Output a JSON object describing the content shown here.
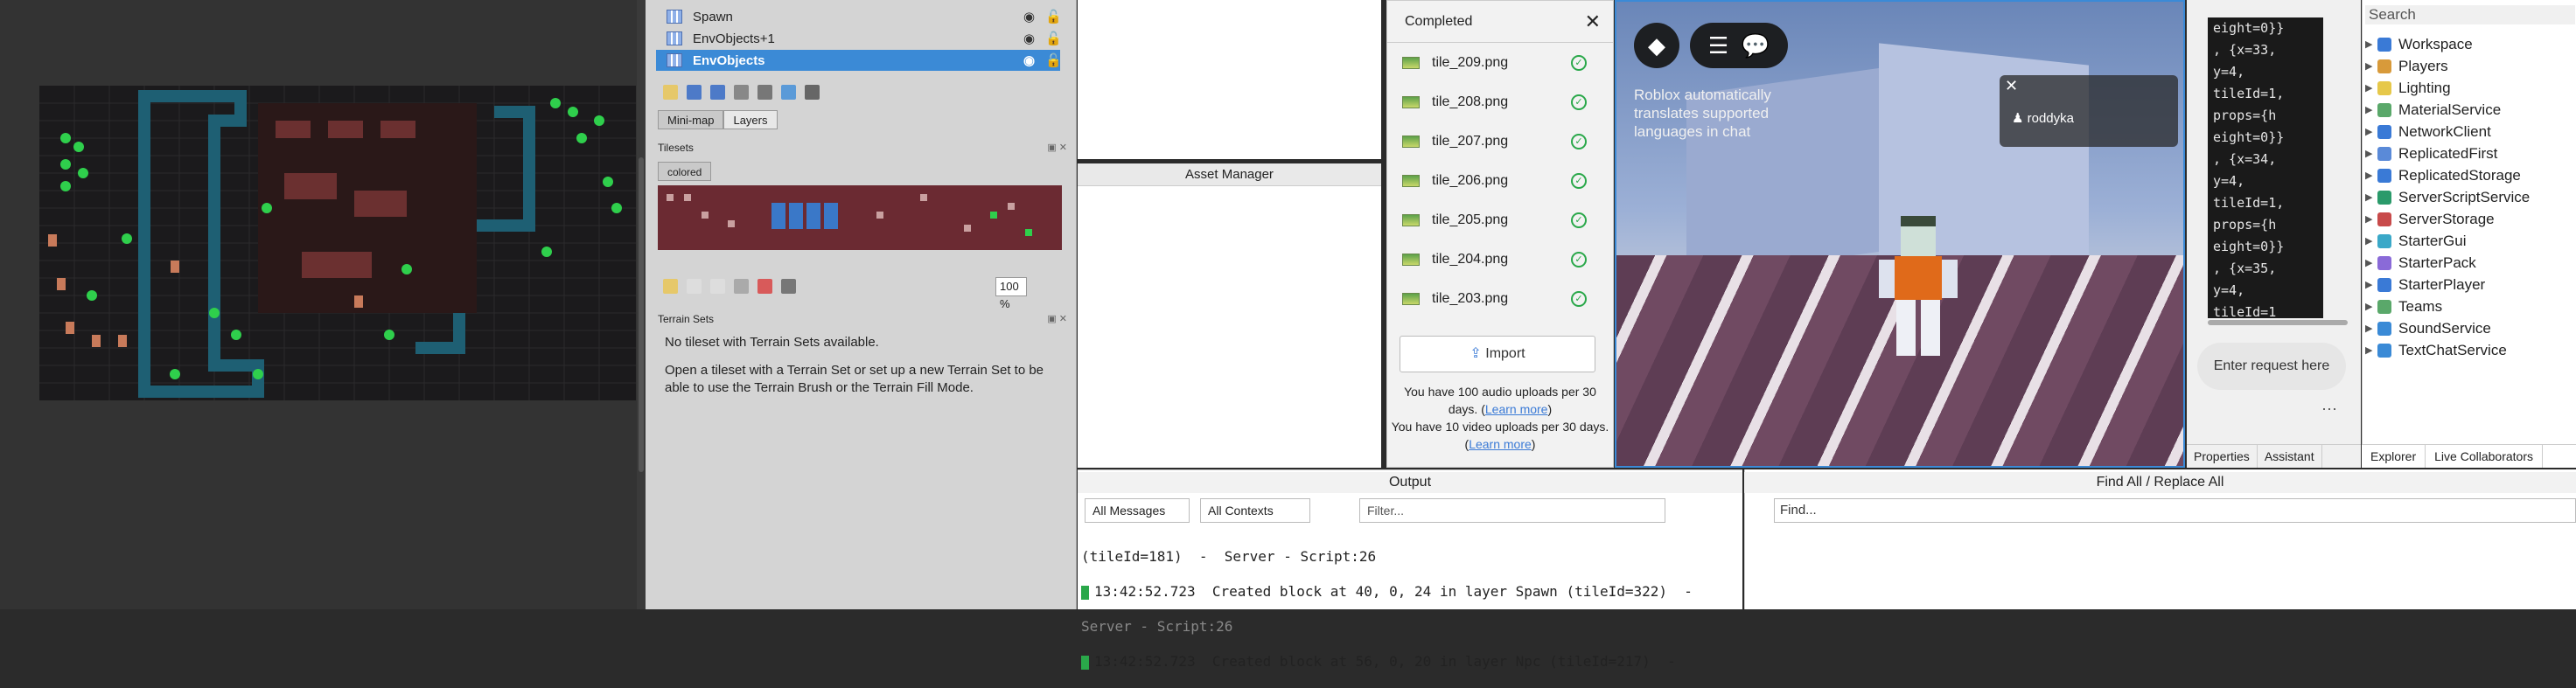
{
  "layers": {
    "items": [
      {
        "label": "Spawn"
      },
      {
        "label": "EnvObjects+1"
      },
      {
        "label": "EnvObjects"
      }
    ]
  },
  "tiled": {
    "tabs": [
      "Mini-map",
      "Layers"
    ],
    "tilesets_header": "Tilesets",
    "tileset_tab": "colored",
    "zoom": "100 %",
    "terrain_header": "Terrain Sets",
    "terrain_msg1": "No tileset with Terrain Sets available.",
    "terrain_msg2": "Open a tileset with a Terrain Set or set up a new Terrain Set to be able to use the Terrain Brush or the Terrain Fill Mode."
  },
  "asset_manager": {
    "title": "Asset Manager"
  },
  "upload": {
    "title": "Completed",
    "files": [
      "tile_209.png",
      "tile_208.png",
      "tile_207.png",
      "tile_206.png",
      "tile_205.png",
      "tile_204.png",
      "tile_203.png"
    ],
    "import_label": "Import",
    "note1": "You have 100 audio uploads per 30 days.",
    "note2": "You have 10 video uploads per 30 days.",
    "learn_more": "Learn more"
  },
  "viewport": {
    "chat_notice": "Roblox automatically translates supported languages in chat",
    "player": "roddyka"
  },
  "assistant": {
    "code": "eight=0}}\n, {x=33,\ny=4,\ntileId=1,\nprops={h\neight=0}}\n, {x=34,\ny=4,\ntileId=1,\nprops={h\neight=0}}\n, {x=35,\ny=4,\ntileId=1",
    "request_placeholder": "Enter request here",
    "tabs": [
      "Properties",
      "Assistant"
    ]
  },
  "explorer": {
    "search": "Search",
    "items": [
      "Workspace",
      "Players",
      "Lighting",
      "MaterialService",
      "NetworkClient",
      "ReplicatedFirst",
      "ReplicatedStorage",
      "ServerScriptService",
      "ServerStorage",
      "StarterGui",
      "StarterPack",
      "StarterPlayer",
      "Teams",
      "SoundService",
      "TextChatService"
    ],
    "tabs": [
      "Explorer",
      "Live Collaborators"
    ]
  },
  "output": {
    "title": "Output",
    "filter_messages": "All Messages",
    "filter_contexts": "All Contexts",
    "filter_placeholder": "Filter...",
    "lines": [
      "(tileId=181)  -  Server - Script:26",
      "13:42:52.723  Created block at 40, 0, 24 in layer Spawn (tileId=322)  -",
      "Server - Script:26",
      "13:42:52.723  Created block at 56, 0, 20 in layer Npc (tileId=217)  -"
    ]
  },
  "find": {
    "title": "Find All / Replace All",
    "placeholder": "Find..."
  },
  "colors": {
    "accent": "#3b8ad6",
    "ok": "#2aa84a"
  }
}
